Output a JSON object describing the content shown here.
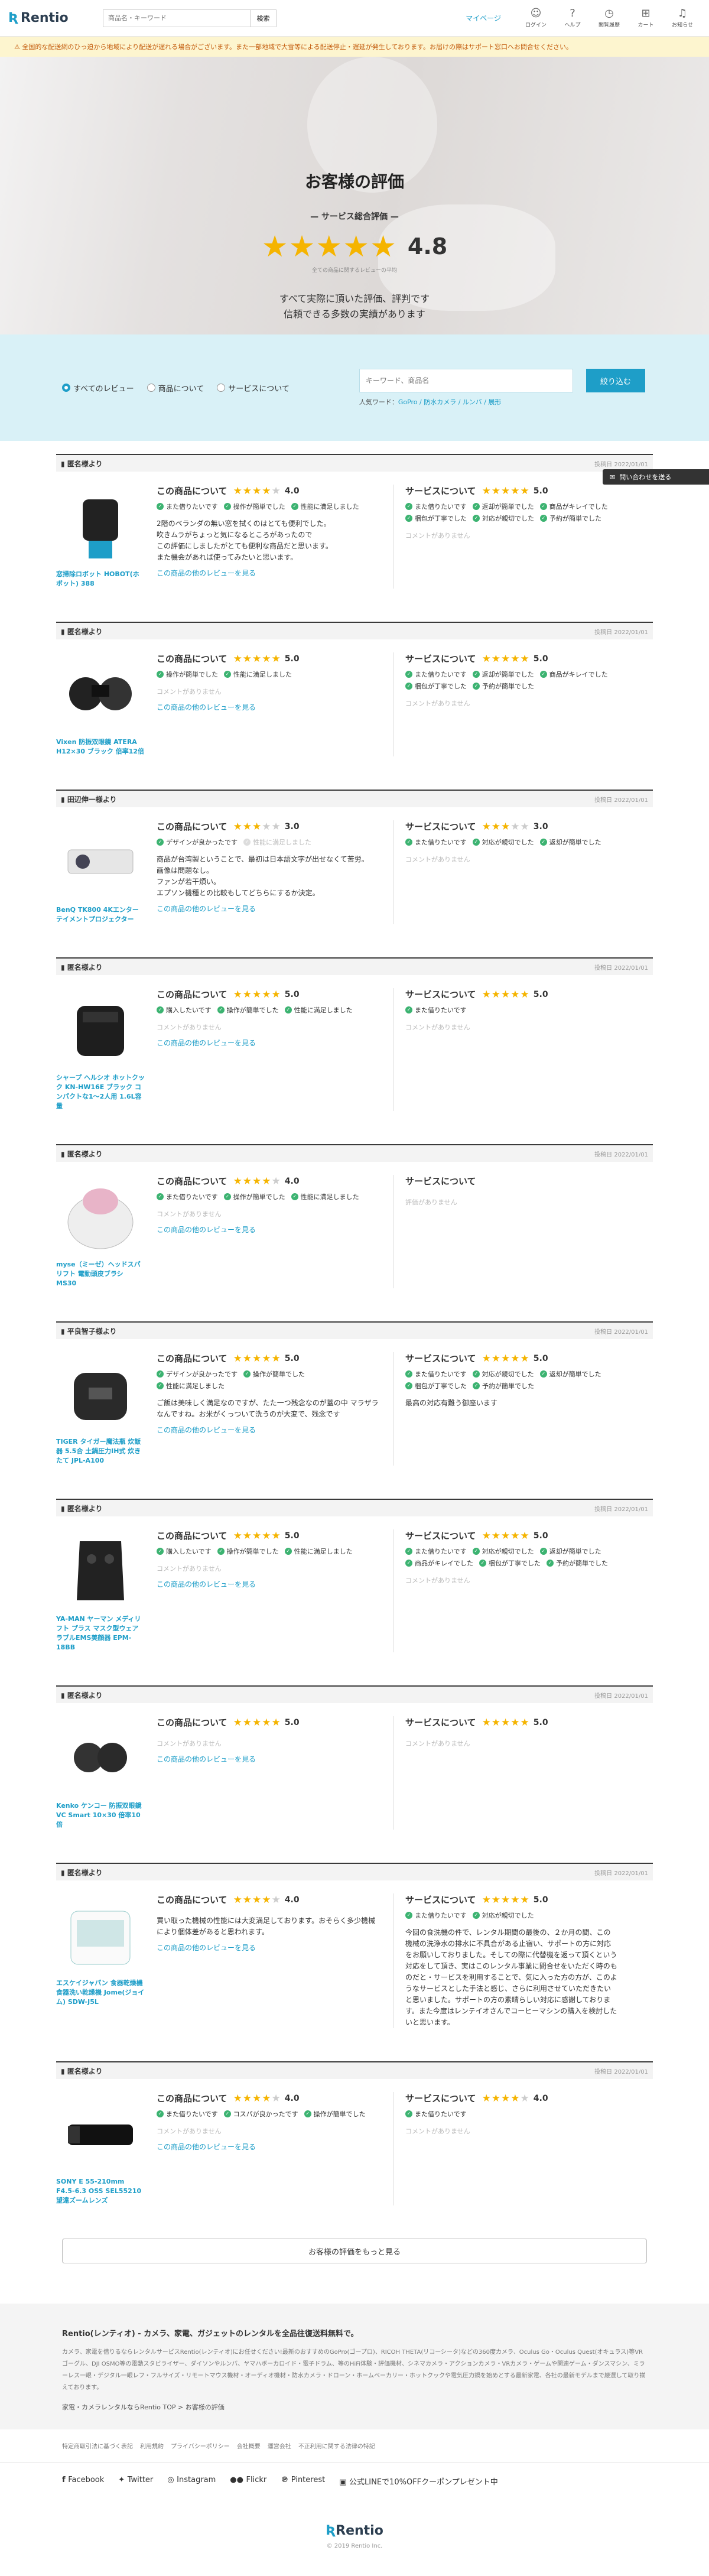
{
  "header": {
    "logo": "Rentio",
    "search_placeholder": "商品名・キーワード",
    "search_button": "検索",
    "mypage": "マイページ",
    "icons": [
      {
        "icon": "login-icon",
        "label": "ログイン"
      },
      {
        "icon": "help-icon",
        "label": "ヘルプ"
      },
      {
        "icon": "history-icon",
        "label": "閲覧履歴"
      },
      {
        "icon": "cart-icon",
        "label": "カート"
      },
      {
        "icon": "bell-icon",
        "label": "お知らせ"
      }
    ]
  },
  "notice": "全国的な配送網のひっ迫から地域により配送が遅れる場合がございます。また一部地域で大雪等による配送停止・遅延が発生しております。お届けの際はサポート窓口へお問合せください。",
  "hero": {
    "title": "お客様の評価",
    "subtitle": "サービス総合評価",
    "stars": "★★★★★",
    "score": "4.8",
    "note": "全ての商品に関するレビューの平均",
    "desc_line1": "すべて実際に頂いた評価、評判です",
    "desc_line2": "信頼できる多数の実績があります"
  },
  "filter": {
    "radios": [
      "すべてのレビュー",
      "商品について",
      "サービスについて"
    ],
    "search_placeholder": "キーワード、商品名",
    "search_button": "絞り込む",
    "popular_label": "人気ワード：",
    "popular_words": "GoPro / 防水カメラ / ルンバ / 展形"
  },
  "contact_button": "問い合わせを送る",
  "labels": {
    "product_heading": "この商品について",
    "service_heading": "サービスについて",
    "no_comment": "コメントがありません",
    "more_reviews": "この商品の他のレビューを見る"
  },
  "reviews": [
    {
      "user": "匿名様より",
      "date": "投稿日 2022/01/01",
      "product_name": "窓掃除ロボット HOBOT(ホボット) 388",
      "product_stars": "★★★★",
      "product_off": "★",
      "product_score": "4.0",
      "product_tags": [
        {
          "t": "また借りたいです",
          "on": true
        },
        {
          "t": "操作が簡単でした",
          "on": true
        },
        {
          "t": "性能に満足しました",
          "on": true
        }
      ],
      "product_comment": "2階のベランダの無い窓を拭くのはとても便利でした。\n吹きムラがちょっと気になるところがあったので\nこの評価にしましたがとても便利な商品だと思います。\nまた機会があれば使ってみたいと思います。",
      "service_stars": "★★★★★",
      "service_off": "",
      "service_score": "5.0",
      "service_tags": [
        {
          "t": "また借りたいです",
          "on": true
        },
        {
          "t": "返却が簡単でした",
          "on": true
        },
        {
          "t": "商品がキレイでした",
          "on": true
        },
        {
          "t": "梱包が丁寧でした",
          "on": true
        },
        {
          "t": "対応が親切でした",
          "on": true
        },
        {
          "t": "予約が簡単でした",
          "on": true
        }
      ],
      "service_comment": ""
    },
    {
      "user": "匿名様より",
      "date": "投稿日 2022/01/01",
      "product_name": "Vixen 防振双眼鏡 ATERA H12×30 ブラック 倍率12倍",
      "product_stars": "★★★★★",
      "product_off": "",
      "product_score": "5.0",
      "product_tags": [
        {
          "t": "操作が簡単でした",
          "on": true
        },
        {
          "t": "性能に満足しました",
          "on": true
        }
      ],
      "product_comment": "",
      "service_stars": "★★★★★",
      "service_off": "",
      "service_score": "5.0",
      "service_tags": [
        {
          "t": "また借りたいです",
          "on": true
        },
        {
          "t": "返却が簡単でした",
          "on": true
        },
        {
          "t": "商品がキレイでした",
          "on": true
        },
        {
          "t": "梱包が丁寧でした",
          "on": true
        },
        {
          "t": "予約が簡単でした",
          "on": true
        }
      ],
      "service_comment": ""
    },
    {
      "user": "田辺伸一様より",
      "date": "投稿日 2022/01/01",
      "product_name": "BenQ TK800 4Kエンターテイメントプロジェクター",
      "product_stars": "★★★",
      "product_off": "★★",
      "product_score": "3.0",
      "product_tags": [
        {
          "t": "デザインが良かったです",
          "on": true
        },
        {
          "t": "性能に満足しました",
          "on": false
        }
      ],
      "product_comment": "商品が台湾製ということで、最初は日本語文字が出せなくて苦労。\n画像は問題なし。\nファンが若干煩い。\nエプソン機種との比較もしてどちらにするか決定。",
      "service_stars": "★★★",
      "service_off": "★★",
      "service_score": "3.0",
      "service_tags": [
        {
          "t": "また借りたいです",
          "on": true
        },
        {
          "t": "対応が親切でした",
          "on": true
        },
        {
          "t": "返却が簡単でした",
          "on": true
        }
      ],
      "service_comment": ""
    },
    {
      "user": "匿名様より",
      "date": "投稿日 2022/01/01",
      "product_name": "シャープ ヘルシオ ホットクック KN-HW16E ブラック コンパクトな1〜2人用 1.6L容量",
      "product_stars": "★★★★★",
      "product_off": "",
      "product_score": "5.0",
      "product_tags": [
        {
          "t": "購入したいです",
          "on": true
        },
        {
          "t": "操作が簡単でした",
          "on": true
        },
        {
          "t": "性能に満足しました",
          "on": true
        }
      ],
      "product_comment": "",
      "service_stars": "★★★★★",
      "service_off": "",
      "service_score": "5.0",
      "service_tags": [
        {
          "t": "また借りたいです",
          "on": true
        }
      ],
      "service_comment": ""
    },
    {
      "user": "匿名様より",
      "date": "投稿日 2022/01/01",
      "product_name": "myse（ミーゼ）ヘッドスパリフト 電動頭皮ブラシ MS30",
      "product_stars": "★★★★",
      "product_off": "★",
      "product_score": "4.0",
      "product_tags": [
        {
          "t": "また借りたいです",
          "on": true
        },
        {
          "t": "操作が簡単でした",
          "on": true
        },
        {
          "t": "性能に満足しました",
          "on": true
        }
      ],
      "product_comment": "",
      "service_stars": "",
      "service_off": "",
      "service_score": "",
      "service_tags": [],
      "service_comment": "評価がありません"
    },
    {
      "user": "平良智子様より",
      "date": "投稿日 2022/01/01",
      "product_name": "TIGER タイガー魔法瓶 炊飯器 5.5合 土鍋圧力IH式 炊きたて JPL-A100",
      "product_stars": "★★★★★",
      "product_off": "",
      "product_score": "5.0",
      "product_tags": [
        {
          "t": "デザインが良かったです",
          "on": true
        },
        {
          "t": "操作が簡単でした",
          "on": true
        },
        {
          "t": "性能に満足しました",
          "on": true
        }
      ],
      "product_comment": "ご飯は美味しく満足なのですが、たた一つ残念なのが蓋の中 マラザラなんですね。お米がくっついて洗うのが大変で、残念です",
      "service_stars": "★★★★★",
      "service_off": "",
      "service_score": "5.0",
      "service_tags": [
        {
          "t": "また借りたいです",
          "on": true
        },
        {
          "t": "対応が親切でした",
          "on": true
        },
        {
          "t": "返却が簡単でした",
          "on": true
        },
        {
          "t": "梱包が丁寧でした",
          "on": true
        },
        {
          "t": "予約が簡単でした",
          "on": true
        }
      ],
      "service_comment": "最高の対応有難う御座います"
    },
    {
      "user": "匿名様より",
      "date": "投稿日 2022/01/01",
      "product_name": "YA-MAN ヤーマン メディリフト プラス マスク型ウェアラブルEMS美顔器 EPM-18BB",
      "product_stars": "★★★★★",
      "product_off": "",
      "product_score": "5.0",
      "product_tags": [
        {
          "t": "購入したいです",
          "on": true
        },
        {
          "t": "操作が簡単でした",
          "on": true
        },
        {
          "t": "性能に満足しました",
          "on": true
        }
      ],
      "product_comment": "",
      "service_stars": "★★★★★",
      "service_off": "",
      "service_score": "5.0",
      "service_tags": [
        {
          "t": "また借りたいです",
          "on": true
        },
        {
          "t": "対応が親切でした",
          "on": true
        },
        {
          "t": "返却が簡単でした",
          "on": true
        },
        {
          "t": "商品がキレイでした",
          "on": true
        },
        {
          "t": "梱包が丁寧でした",
          "on": true
        },
        {
          "t": "予約が簡単でした",
          "on": true
        }
      ],
      "service_comment": ""
    },
    {
      "user": "匿名様より",
      "date": "投稿日 2022/01/01",
      "product_name": "Kenko ケンコー 防振双眼鏡 VC Smart 10×30 倍率10倍",
      "product_stars": "★★★★★",
      "product_off": "",
      "product_score": "5.0",
      "product_tags": [],
      "product_comment": "",
      "service_stars": "★★★★★",
      "service_off": "",
      "service_score": "5.0",
      "service_tags": [],
      "service_comment": ""
    },
    {
      "user": "匿名様より",
      "date": "投稿日 2022/01/01",
      "product_name": "エスケイジャパン 食器乾燥機 食器洗い乾燥機 Jome(ジョイム) SDW-J5L",
      "product_stars": "★★★★",
      "product_off": "★",
      "product_score": "4.0",
      "product_tags": [],
      "product_comment": "買い取った機械の性能には大変満足しております。おそらく多少機械により個体差があると思われます。",
      "service_stars": "★★★★★",
      "service_off": "",
      "service_score": "5.0",
      "service_tags": [
        {
          "t": "また借りたいです",
          "on": true
        },
        {
          "t": "対応が親切でした",
          "on": true
        }
      ],
      "service_comment": "今回の食洗機の件で、レンタル期間の最後の、２か月の間、この機械の洗浄水の排水に不具合がある止宿い、サポートの方に対応をお願いしておりました。そしての際に代替機を返って頂くという対応をして頂き、実はこのレンタル事業に問合せをいただく時のものだと・サービスを利用することで、気に入った方の方が、このようなサービスとした手法と感じ、さらに利用させていただきたいと思いました。サポートの方の素晴らしい対応に感謝しております。また今度はレンテイオさんでコーヒーマシンの購入を検討したいと思います。"
    },
    {
      "user": "匿名様より",
      "date": "投稿日 2022/01/01",
      "product_name": "SONY E 55-210mm F4.5-6.3 OSS SEL55210 望遠ズームレンズ",
      "product_stars": "★★★★",
      "product_off": "★",
      "product_score": "4.0",
      "product_tags": [
        {
          "t": "また借りたいです",
          "on": true
        },
        {
          "t": "コスパが良かったです",
          "on": true
        },
        {
          "t": "操作が簡単でした",
          "on": true
        }
      ],
      "product_comment": "",
      "service_stars": "★★★★",
      "service_off": "★",
      "service_score": "4.0",
      "service_tags": [
        {
          "t": "また借りたいです",
          "on": true
        }
      ],
      "service_comment": ""
    }
  ],
  "load_more": "お客様の評価をもっと見る",
  "footer": {
    "title": "Rentio(レンティオ) - カメラ、家電、ガジェットのレンタルを全品往復送料無料で。",
    "text": "カメラ、家電を借りるならレンタルサービスRentio(レンティオ)にお任せください!最新のおすすめのGoPro(ゴープロ)、RICOH THETA(リコーシータ)などの360度カメラ、Oculus Go・Oculus Quest(オキュラス)等VRゴーグル、DJI OSMO等の電動スタビライザー、ダイソンやルンバ、ヤマハボーカロイド・電子ドラム、等のHiFi体験・評価機材、シネマカメラ・アクションカメラ・VRカメラ・ゲームや関連ゲーム・ダンスマシン、ミラーレス一眼・デジタル一眼レフ・フルサイズ・リモートマウス機材・オーディオ機材・防水カメラ・ドローン・ホームベーカリー・ホットクックや電気圧力鍋を始めとする最新家電、各社の最新モデルまで厳選して取り揃えております。",
    "breadcrumb": "家電・カメラレンタルならRentio TOP > お客様の評価"
  },
  "footer_links": [
    "特定商取引法に基づく表記",
    "利用規約",
    "プライバシーポリシー",
    "会社概要",
    "運営会社",
    "不正利用に関する法律の特記"
  ],
  "social": [
    {
      "icon": "facebook-icon",
      "label": "Facebook"
    },
    {
      "icon": "twitter-icon",
      "label": "Twitter"
    },
    {
      "icon": "instagram-icon",
      "label": "Instagram"
    },
    {
      "icon": "flickr-icon",
      "label": "Flickr"
    },
    {
      "icon": "pinterest-icon",
      "label": "Pinterest"
    },
    {
      "icon": "line-icon",
      "label": "公式LINEで10%OFFクーポンプレゼント中"
    }
  ],
  "copyright": "© 2019 Rentio Inc.",
  "colors": {
    "accent": "#1e9ec8",
    "star": "#f5b400",
    "check": "#3cb371",
    "notice_bg": "#fdf5cf"
  }
}
